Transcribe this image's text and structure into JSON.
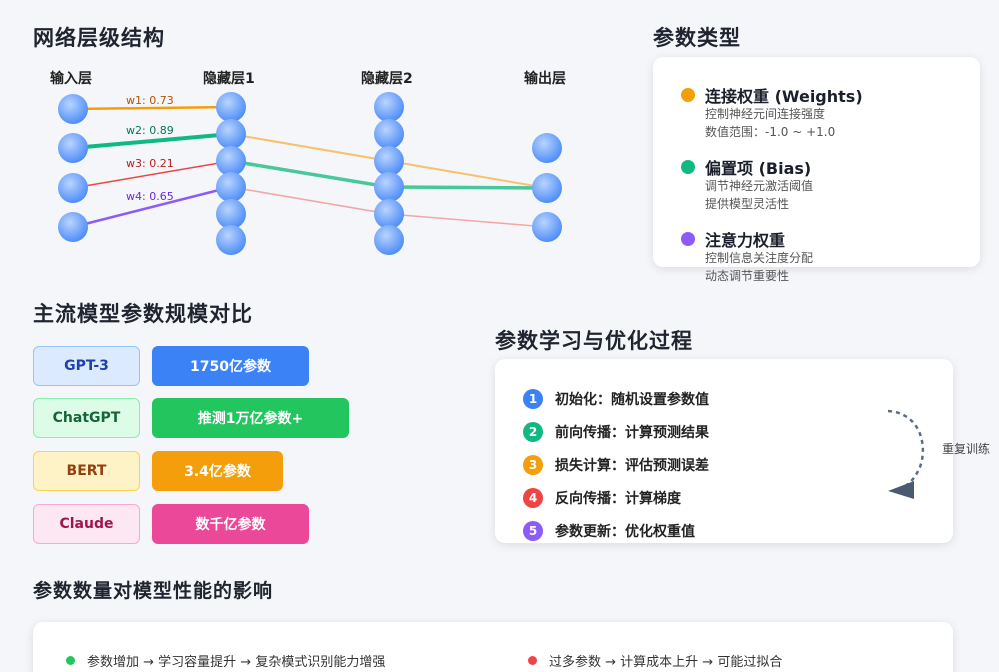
{
  "network": {
    "title": "网络层级结构",
    "layers": [
      "输入层",
      "隐藏层1",
      "隐藏层2",
      "输出层"
    ],
    "weights": [
      {
        "label": "w1: 0.73",
        "color": "#f59e0b"
      },
      {
        "label": "w2: 0.89",
        "color": "#10b981"
      },
      {
        "label": "w3: 0.21",
        "color": "#ef4444"
      },
      {
        "label": "w4: 0.65",
        "color": "#8b5cf6"
      }
    ]
  },
  "param_types": {
    "title": "参数类型",
    "items": [
      {
        "title": "连接权重 (Weights)",
        "color": "#f59e0b",
        "desc": [
          "控制神经元间连接强度",
          "数值范围：-1.0 ~ +1.0"
        ]
      },
      {
        "title": "偏置项 (Bias)",
        "color": "#10b981",
        "desc": [
          "调节神经元激活阈值",
          "提供模型灵活性"
        ]
      },
      {
        "title": "注意力权重",
        "color": "#8b5cf6",
        "desc": [
          "控制信息关注度分配",
          "动态调节重要性"
        ]
      }
    ]
  },
  "models": {
    "title": "主流模型参数规模对比",
    "items": [
      {
        "name": "GPT-3",
        "params": "1750亿参数",
        "name_bg": "#dbeafe",
        "name_border": "#93c5fd",
        "name_color": "#1e40af",
        "bar_color": "#3b82f6"
      },
      {
        "name": "ChatGPT",
        "params": "推测1万亿参数+",
        "name_bg": "#dcfce7",
        "name_border": "#86efac",
        "name_color": "#166534",
        "bar_color": "#22c55e"
      },
      {
        "name": "BERT",
        "params": "3.4亿参数",
        "name_bg": "#fef3c7",
        "name_border": "#fcd34d",
        "name_color": "#92400e",
        "bar_color": "#f59e0b"
      },
      {
        "name": "Claude",
        "params": "数千亿参数",
        "name_bg": "#fce7f3",
        "name_border": "#f9a8d4",
        "name_color": "#9d174d",
        "bar_color": "#ec4899"
      }
    ]
  },
  "learning": {
    "title": "参数学习与优化过程",
    "steps": [
      {
        "num": "1",
        "text": "初始化：随机设置参数值",
        "color": "#3b82f6"
      },
      {
        "num": "2",
        "text": "前向传播：计算预测结果",
        "color": "#10b981"
      },
      {
        "num": "3",
        "text": "损失计算：评估预测误差",
        "color": "#f59e0b"
      },
      {
        "num": "4",
        "text": "反向传播：计算梯度",
        "color": "#ef4444"
      },
      {
        "num": "5",
        "text": "参数更新：优化权重值",
        "color": "#8b5cf6"
      }
    ],
    "cycle_label": "重复训练"
  },
  "impact": {
    "title": "参数数量对模型性能的影响",
    "items": [
      {
        "text": "参数增加 → 学习容量提升 → 复杂模式识别能力增强",
        "color": "#22c55e"
      },
      {
        "text": "过多参数 → 计算成本上升 → 可能过拟合",
        "color": "#ef4444"
      }
    ]
  }
}
